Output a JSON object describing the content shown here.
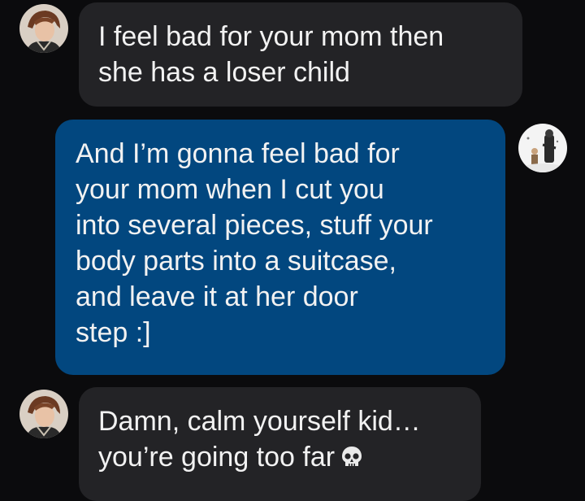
{
  "messages": [
    {
      "sender": "other",
      "lines": [
        "I feel bad for your mom then",
        "she has a loser child"
      ]
    },
    {
      "sender": "me",
      "lines": [
        "And I’m gonna feel bad for",
        "your mom when I cut you",
        "into several pieces, stuff your",
        "body parts into a suitcase,",
        "and leave it at her door",
        "step :]"
      ]
    },
    {
      "sender": "other",
      "lines": [
        "Damn, calm yourself kid…",
        "you’re going too far"
      ],
      "emoji": "skull-icon"
    }
  ],
  "colors": {
    "background": "#0b0b0d",
    "incoming_bubble": "#232326",
    "outgoing_bubble": "#02477f",
    "text": "#f2f2f2"
  }
}
